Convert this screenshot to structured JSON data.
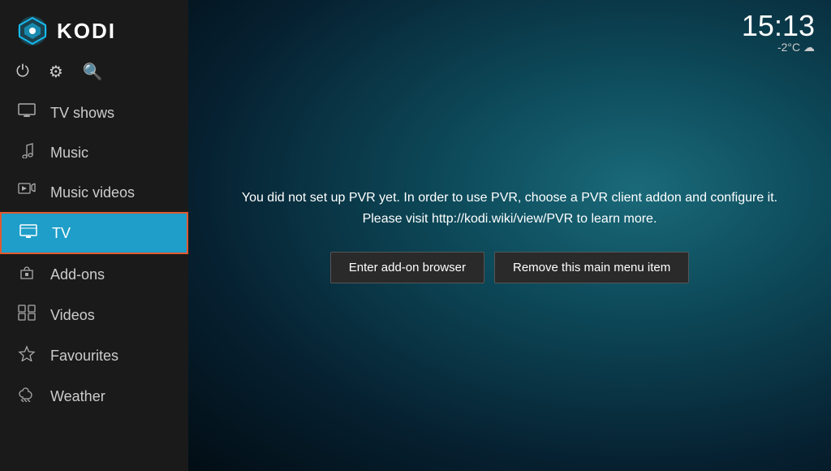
{
  "app": {
    "title": "KODI"
  },
  "clock": {
    "time": "15:13",
    "weather": "-2°C ☁"
  },
  "toolbar": {
    "power_icon": "⏻",
    "settings_icon": "⚙",
    "search_icon": "🔍"
  },
  "sidebar": {
    "items": [
      {
        "id": "tv-shows",
        "label": "TV shows",
        "icon": "🖥",
        "active": false
      },
      {
        "id": "music",
        "label": "Music",
        "icon": "🎧",
        "active": false
      },
      {
        "id": "music-videos",
        "label": "Music videos",
        "icon": "🎬",
        "active": false
      },
      {
        "id": "tv",
        "label": "TV",
        "icon": "📺",
        "active": true
      },
      {
        "id": "add-ons",
        "label": "Add-ons",
        "icon": "🎁",
        "active": false
      },
      {
        "id": "videos",
        "label": "Videos",
        "icon": "▦",
        "active": false
      },
      {
        "id": "favourites",
        "label": "Favourites",
        "icon": "★",
        "active": false
      },
      {
        "id": "weather",
        "label": "Weather",
        "icon": "⛅",
        "active": false
      }
    ]
  },
  "pvr": {
    "message": "You did not set up PVR yet. In order to use PVR, choose a PVR client addon and configure it.\nPlease visit http://kodi.wiki/view/PVR to learn more.",
    "btn_addon_browser": "Enter add-on browser",
    "btn_remove_menu": "Remove this main menu item"
  }
}
